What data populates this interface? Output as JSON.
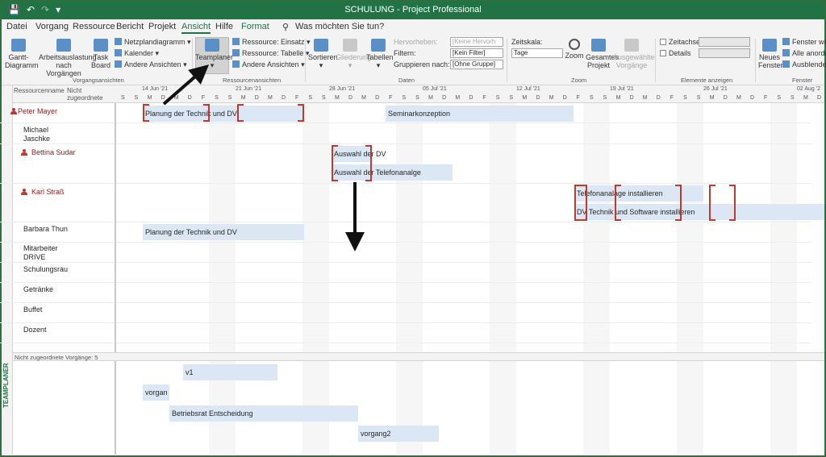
{
  "window": {
    "title": "SCHULUNG - Project Professional"
  },
  "menu": {
    "tabs": [
      "Datei",
      "Vorgang",
      "Ressource",
      "Bericht",
      "Projekt",
      "Ansicht",
      "Hilfe",
      "Format"
    ],
    "active": "Ansicht",
    "tell_me": "Was möchten Sie tun?"
  },
  "ribbon": {
    "gantt": "Gantt-Diagramm",
    "arbeitsauslastung": "Arbeitsauslastung nach Vorgängen",
    "task_board": "Task Board",
    "netzplan": "Netzplandiagramm",
    "kalender": "Kalender",
    "andere1": "Andere Ansichten",
    "teamplaner": "Teamplaner",
    "res_einsatz": "Ressource: Einsatz",
    "res_tabelle": "Ressource: Tabelle",
    "andere2": "Andere Ansichten",
    "sortieren": "Sortieren",
    "gliederung": "Gliederung",
    "tabellen": "Tabellen",
    "hervorheben": "Hervorheben:",
    "hervorheben_val": "[Keine Hervorh",
    "filtern": "Filtern:",
    "filtern_val": "[Kein Filter]",
    "gruppieren": "Gruppieren nach:",
    "gruppieren_val": "[Ohne Gruppe]",
    "zeitskala": "Zeitskala:",
    "zeitskala_val": "Tage",
    "zoom": "Zoom",
    "gesamtes": "Gesamtes Projekt",
    "ausgewaehlte": "Ausgewählte Vorgänge",
    "zeitachse": "Zeitachse",
    "details": "Details",
    "neues_fenster": "Neues Fenster",
    "fenster_wechseln": "Fenster wech",
    "alle_anordnen": "Alle anordne",
    "ausblenden": "Ausblenden",
    "groups": {
      "vorgangsansichten": "Vorgangsansichten",
      "ressourcenansichten": "Ressourcenansichten",
      "daten": "Daten",
      "zoom": "Zoom",
      "elemente": "Elemente anzeigen",
      "fenster": "Fenster"
    }
  },
  "sidebar_label": "TEAMPLANER",
  "grid": {
    "col_name": "Ressourcenname",
    "col_unassigned": "Nicht zugeordnete",
    "week_dates": [
      "14 Jun '21",
      "21 Jun '21",
      "28 Jun '21",
      "05 Jul '21",
      "12 Jul '21",
      "19 Jul '21",
      "26 Jul '21",
      "02 Aug '2"
    ],
    "day_letters": [
      "S",
      "S",
      "M",
      "D",
      "M",
      "D",
      "F",
      "S",
      "S",
      "M",
      "D",
      "M",
      "D",
      "F",
      "S",
      "S",
      "M",
      "D",
      "M",
      "D",
      "F",
      "S",
      "S",
      "M",
      "D",
      "M",
      "D",
      "F",
      "S",
      "S",
      "M",
      "D",
      "M",
      "D",
      "F",
      "S",
      "S",
      "M",
      "D",
      "M",
      "D",
      "F",
      "S",
      "S",
      "M",
      "D",
      "M",
      "D",
      "F",
      "S",
      "S",
      "M",
      "D"
    ]
  },
  "resources": [
    {
      "name": "Peter Mayer",
      "overallocated": true
    },
    {
      "name": "Michael Jaschke",
      "overallocated": false
    },
    {
      "name": "Bettina Sudar",
      "overallocated": true
    },
    {
      "name": "Karl Straß",
      "overallocated": true
    },
    {
      "name": "Barbara Thun",
      "overallocated": false
    },
    {
      "name": "Mitarbeiter DRIVE",
      "overallocated": false
    },
    {
      "name": "Schulungsrau",
      "overallocated": false
    },
    {
      "name": "Getränke",
      "overallocated": false
    },
    {
      "name": "Buffet",
      "overallocated": false
    },
    {
      "name": "Dozent",
      "overallocated": false
    }
  ],
  "tasks": {
    "peter1": "Planung der Technik und DV",
    "peter2": "Seminarkonzeption",
    "bettina1": "Auswahl der DV",
    "bettina2": "Auswahl der Telefonanalge",
    "karl1": "Telefonanalage installieren",
    "karl2": "DV Technik und Software installieren",
    "barbara1": "Planung der Technik und DV"
  },
  "unassigned": {
    "header": "Nicht zugeordnete Vorgänge: 5",
    "tasks": [
      "v1",
      "vorgan",
      "Betriebsrat Entscheidung",
      "vorgang2"
    ]
  }
}
